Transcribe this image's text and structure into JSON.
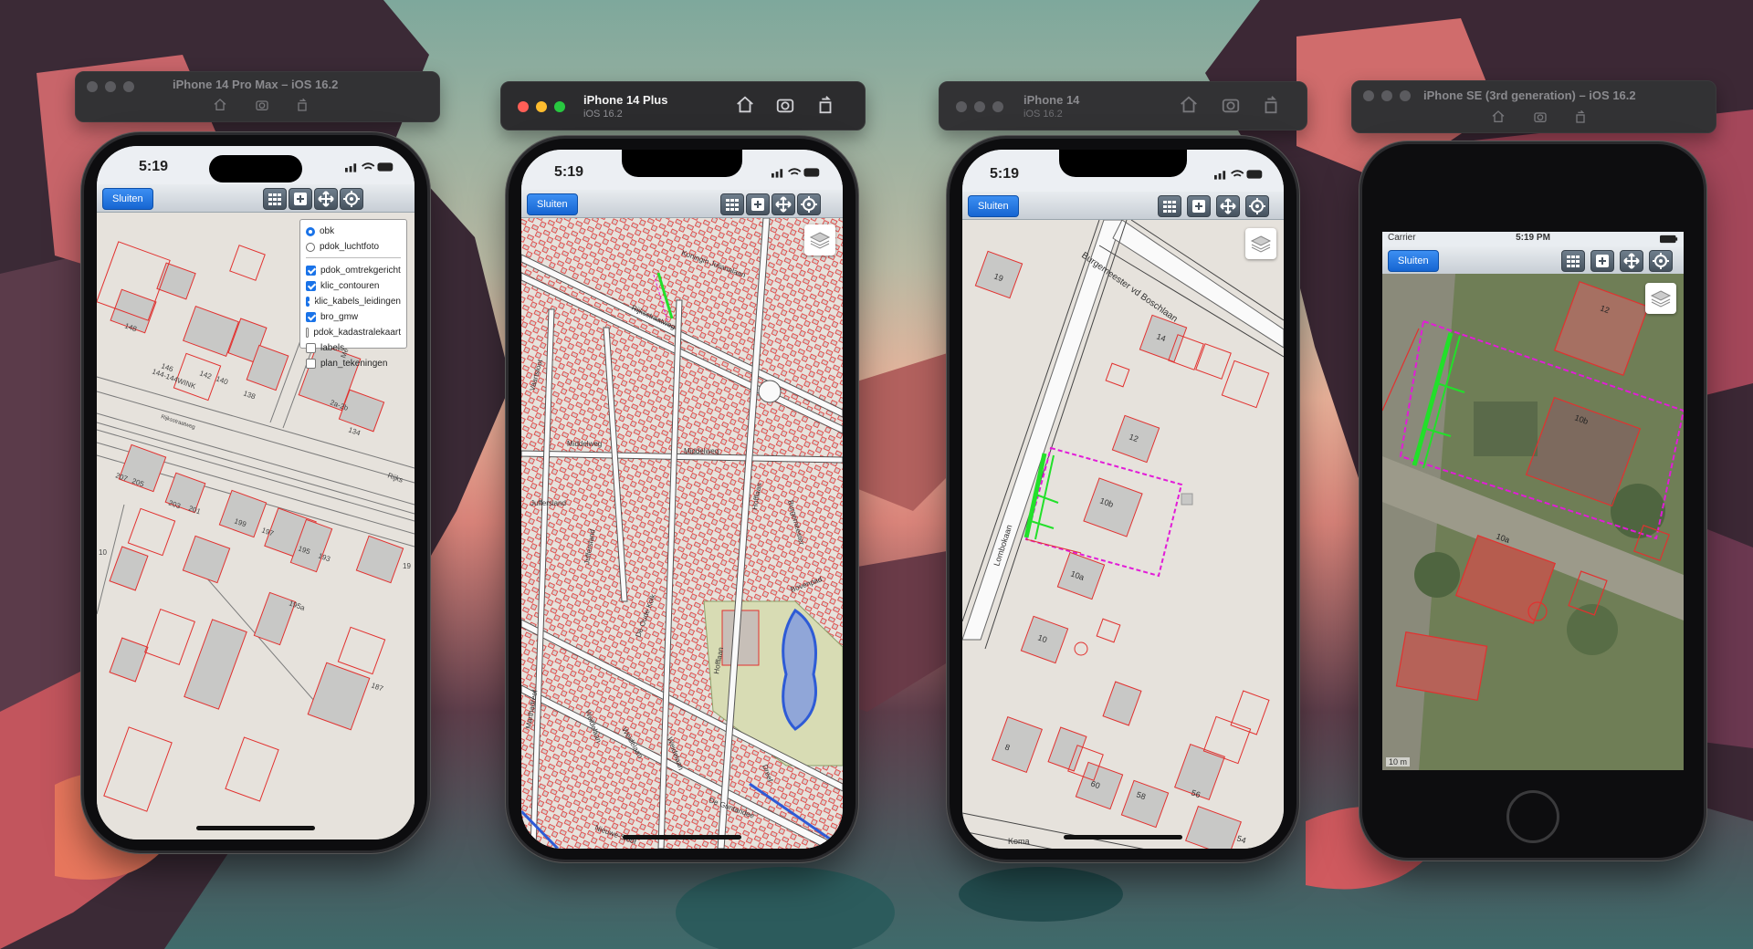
{
  "simulators": [
    {
      "title": "iPhone 14 Pro Max – iOS 16.2",
      "subtitle": "",
      "active": false
    },
    {
      "title": "iPhone 14 Plus",
      "subtitle": "iOS 16.2",
      "active": true
    },
    {
      "title": "iPhone 14",
      "subtitle": "iOS 16.2",
      "active": false
    },
    {
      "title": "iPhone SE (3rd generation) – iOS 16.2",
      "subtitle": "",
      "active": false
    }
  ],
  "phones": [
    {
      "time": "5:19",
      "close_label": "Sluiten"
    },
    {
      "time": "5:19",
      "close_label": "Sluiten"
    },
    {
      "time": "5:19",
      "close_label": "Sluiten"
    },
    {
      "carrier": "Carrier",
      "time": "5:19 PM",
      "close_label": "Sluiten",
      "scale": "10 m"
    }
  ],
  "layer_panel": {
    "base_layers": [
      {
        "label": "obk",
        "selected": true
      },
      {
        "label": "pdok_luchtfoto",
        "selected": false
      }
    ],
    "overlays": [
      {
        "label": "pdok_omtrekgericht",
        "checked": true
      },
      {
        "label": "klic_contouren",
        "checked": true
      },
      {
        "label": "klic_kabels_leidingen",
        "checked": true
      },
      {
        "label": "bro_gmw",
        "checked": true
      },
      {
        "label": "pdok_kadastralekaart",
        "checked": false
      },
      {
        "label": "labels",
        "checked": false
      },
      {
        "label": "plan_tekeningen",
        "checked": false
      }
    ]
  },
  "map_labels": {
    "phone1": [
      "148",
      "146",
      "142",
      "140",
      "138",
      "144-144WINK",
      "2a-2b",
      "134",
      "207",
      "205",
      "203",
      "201",
      "199",
      "197",
      "195",
      "193",
      "19",
      "195a",
      "187",
      "10",
      "Mees",
      "Rijks",
      "Rijksstraatweg"
    ],
    "phone2": [
      "Koningin Julianalaan",
      "Rijksstraatweg",
      "Vaartsloot",
      "Middelweg",
      "Middelweg",
      "Juffersland",
      "Juffersland",
      "Hofflaan",
      "Hofflaan",
      "Burgemeester",
      "Bovenpad",
      "De Oude Kolk",
      "Weidelaan",
      "Weidelaan",
      "Weidelaan",
      "Dreef",
      "De Guntandee",
      "Nieuwe-Sloot",
      "Marthadreef"
    ],
    "phone3": [
      "Burgemeester vd Boschlaan",
      "19",
      "14",
      "12",
      "10b",
      "10a",
      "10",
      "8",
      "60",
      "58",
      "56",
      "54",
      "Lombokaan",
      "Koma"
    ],
    "phone4": [
      "12",
      "10b",
      "10a"
    ]
  },
  "colors": {
    "parcel": "#e2312f",
    "building": "#c9c8c6",
    "road": "#ffffff",
    "cable": "#22e02a",
    "plan": "#e21bd8",
    "water": "#2e5bd6"
  }
}
